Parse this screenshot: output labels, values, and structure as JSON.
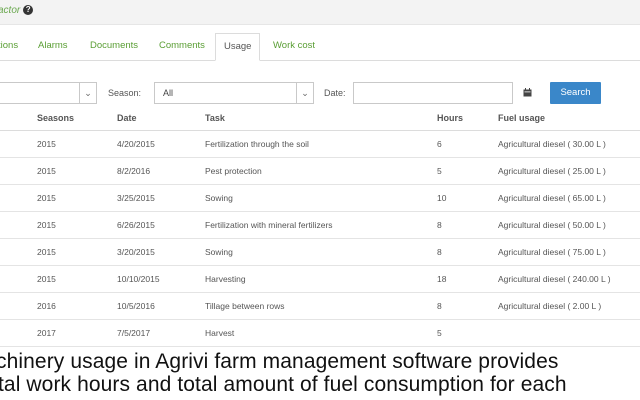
{
  "breadcrumb": {
    "text": "actor",
    "help_glyph": "?"
  },
  "tabs": [
    {
      "label": "tions",
      "active": false
    },
    {
      "label": "Alarms",
      "active": false
    },
    {
      "label": "Documents",
      "active": false
    },
    {
      "label": "Comments",
      "active": false
    },
    {
      "label": "Usage",
      "active": true
    },
    {
      "label": "Work cost",
      "active": false
    }
  ],
  "filters": {
    "first_select_value": "",
    "season_label": "Season:",
    "season_value": "All",
    "date_label": "Date:",
    "date_value": "",
    "search_label": "Search"
  },
  "table": {
    "headers": [
      "Seasons",
      "Date",
      "Task",
      "Hours",
      "Fuel usage"
    ],
    "rows": [
      [
        "2015",
        "4/20/2015",
        "Fertilization through the soil",
        "6",
        "Agricultural diesel ( 30.00 L )"
      ],
      [
        "2015",
        "8/2/2016",
        "Pest protection",
        "5",
        "Agricultural diesel ( 25.00 L )"
      ],
      [
        "2015",
        "3/25/2015",
        "Sowing",
        "10",
        "Agricultural diesel ( 65.00 L )"
      ],
      [
        "2015",
        "6/26/2015",
        "Fertilization with mineral fertilizers",
        "8",
        "Agricultural diesel ( 50.00 L )"
      ],
      [
        "2015",
        "3/20/2015",
        "Sowing",
        "8",
        "Agricultural diesel ( 75.00 L )"
      ],
      [
        "2015",
        "10/10/2015",
        "Harvesting",
        "18",
        "Agricultural diesel ( 240.00 L )"
      ],
      [
        "2016",
        "10/5/2016",
        "Tillage between rows",
        "8",
        "Agricultural diesel ( 2.00 L )"
      ],
      [
        "2017",
        "7/5/2017",
        "Harvest",
        "5",
        ""
      ]
    ]
  },
  "caption": {
    "line1": "chinery usage in Agrivi farm management software provides",
    "line2": "tal work hours and total amount of fuel consumption for each"
  },
  "colors": {
    "link_green": "#5a9e34",
    "button_blue": "#3a87c9"
  }
}
